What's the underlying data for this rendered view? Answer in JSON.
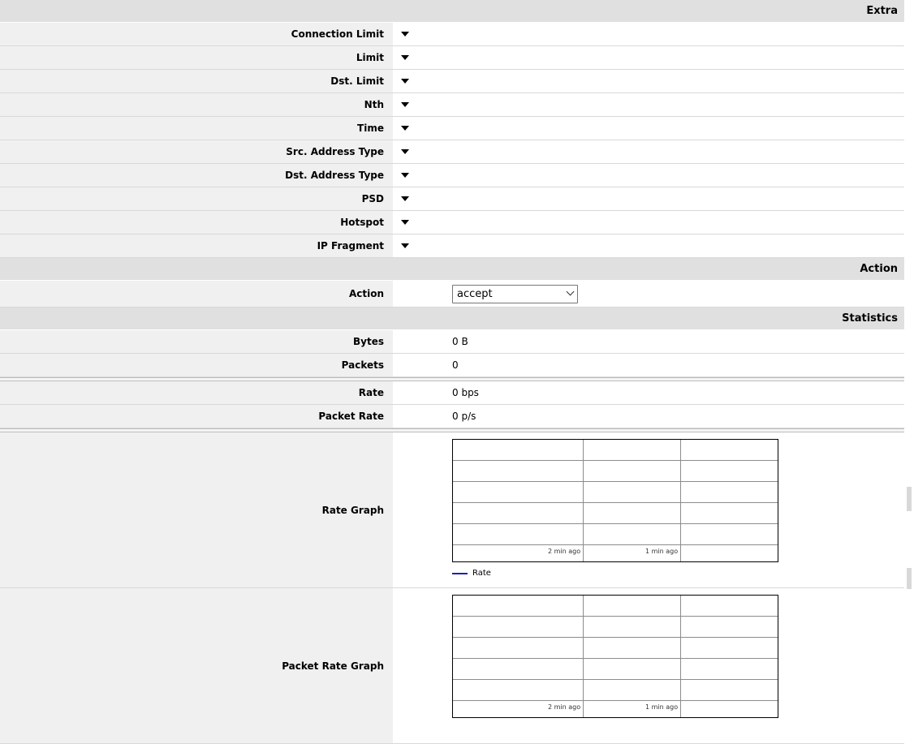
{
  "sections": {
    "extra": "Extra",
    "action": "Action",
    "statistics": "Statistics"
  },
  "extra_rows": [
    {
      "label": "Connection Limit"
    },
    {
      "label": "Limit"
    },
    {
      "label": "Dst. Limit"
    },
    {
      "label": "Nth"
    },
    {
      "label": "Time"
    },
    {
      "label": "Src. Address Type"
    },
    {
      "label": "Dst. Address Type"
    },
    {
      "label": "PSD"
    },
    {
      "label": "Hotspot"
    },
    {
      "label": "IP Fragment"
    }
  ],
  "action": {
    "label": "Action",
    "selected": "accept"
  },
  "stats": {
    "bytes_label": "Bytes",
    "bytes_value": "0 B",
    "packets_label": "Packets",
    "packets_value": "0",
    "rate_label": "Rate",
    "rate_value": "0 bps",
    "packet_rate_label": "Packet Rate",
    "packet_rate_value": "0 p/s"
  },
  "graphs": {
    "rate": {
      "label": "Rate Graph",
      "tick1": "2 min ago",
      "tick2": "1 min ago",
      "legend": "Rate",
      "legend_color": "#2020b0"
    },
    "packet_rate": {
      "label": "Packet Rate Graph",
      "tick1": "2 min ago",
      "tick2": "1 min ago"
    }
  }
}
